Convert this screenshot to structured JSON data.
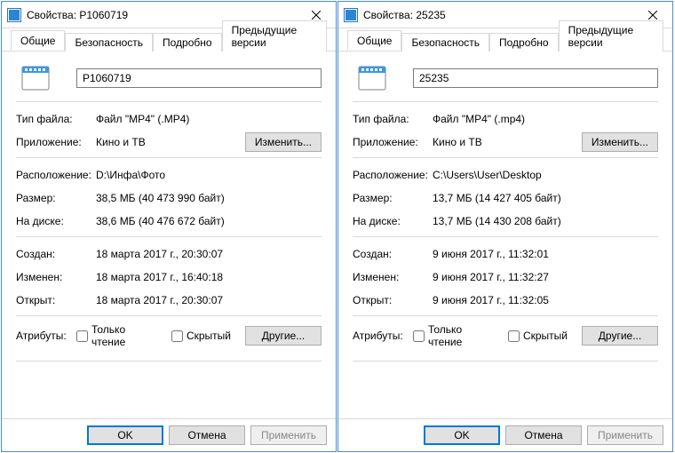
{
  "labels": {
    "tab_general": "Общие",
    "tab_security": "Безопасность",
    "tab_details": "Подробно",
    "tab_prev": "Предыдущие версии",
    "filetype": "Тип файла:",
    "app": "Приложение:",
    "change_btn": "Изменить...",
    "location": "Расположение:",
    "size": "Размер:",
    "ondisk": "На диске:",
    "created": "Создан:",
    "modified": "Изменен:",
    "accessed": "Открыт:",
    "attributes": "Атрибуты:",
    "attr_readonly": "Только чтение",
    "attr_hidden": "Скрытый",
    "other_btn": "Другие...",
    "ok": "OK",
    "cancel": "Отмена",
    "apply": "Применить"
  },
  "windows": [
    {
      "title": "Свойства: P1060719",
      "filename": "P1060719",
      "filetype": "Файл \"MP4\" (.MP4)",
      "app": "Кино и ТВ",
      "location": "D:\\Инфа\\Фото",
      "size": "38,5 МБ (40 473 990 байт)",
      "ondisk": "38,6 МБ (40 476 672 байт)",
      "created": "18 марта 2017 г., 20:30:07",
      "modified": "18 марта 2017 г., 16:40:18",
      "accessed": "18 марта 2017 г., 20:30:07"
    },
    {
      "title": "Свойства: 25235",
      "filename": "25235",
      "filetype": "Файл \"MP4\" (.mp4)",
      "app": "Кино и ТВ",
      "location": "C:\\Users\\User\\Desktop",
      "size": "13,7 МБ (14 427 405 байт)",
      "ondisk": "13,7 МБ (14 430 208 байт)",
      "created": "9 июня 2017 г., 11:32:01",
      "modified": "9 июня 2017 г., 11:32:27",
      "accessed": "9 июня 2017 г., 11:32:05"
    }
  ]
}
